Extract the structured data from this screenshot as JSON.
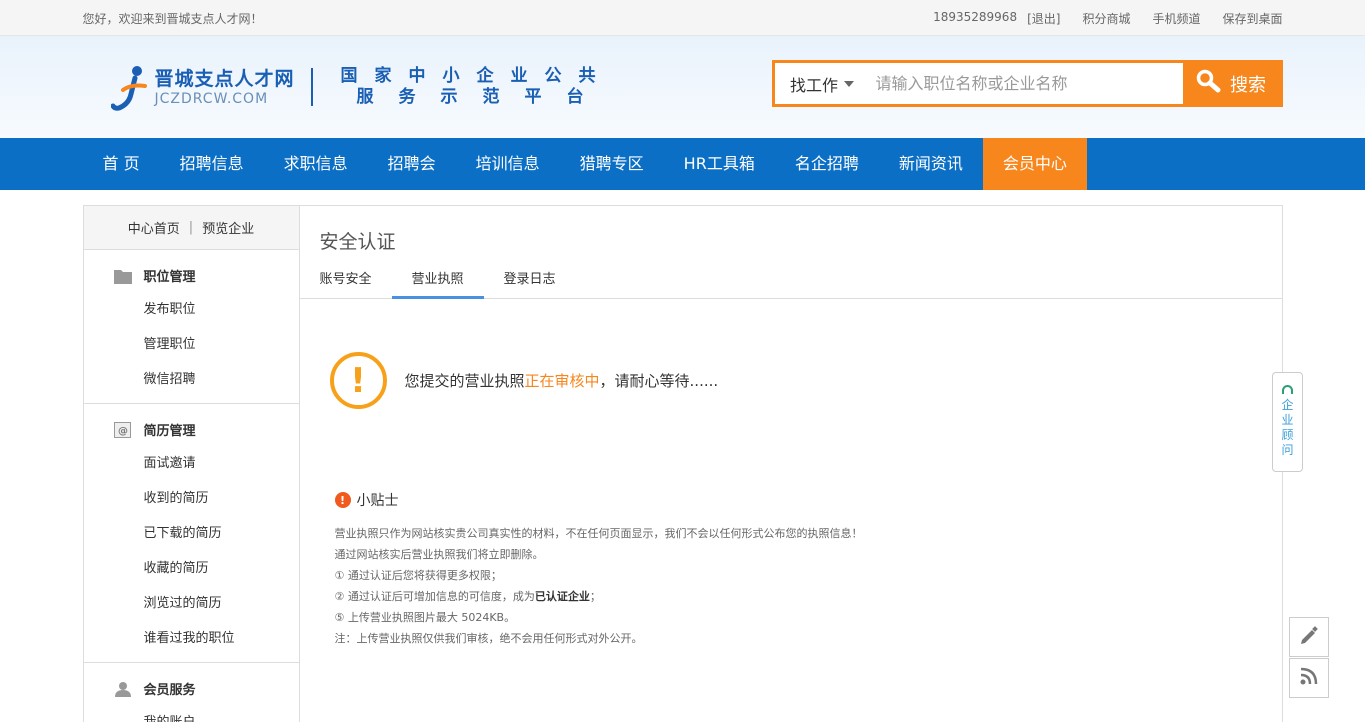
{
  "topbar": {
    "welcome": "您好，欢迎来到晋城支点人才网！",
    "phone": "18935289968",
    "logout": "[退出]",
    "links": [
      "积分商城",
      "手机频道",
      "保存到桌面"
    ]
  },
  "header": {
    "logo_cn": "晋城支点人才网",
    "logo_en": "JCZDRCW.COM",
    "slogan_line1": "国家中小企业公共",
    "slogan_line2": "服务示范平台",
    "search": {
      "type_label": "找工作",
      "placeholder": "请输入职位名称或企业名称",
      "button_label": "搜索"
    }
  },
  "nav": {
    "items": [
      "首 页",
      "招聘信息",
      "求职信息",
      "招聘会",
      "培训信息",
      "猎聘专区",
      "HR工具箱",
      "名企招聘",
      "新闻资讯",
      "会员中心"
    ],
    "active": "会员中心"
  },
  "sidebar": {
    "top_links": [
      "中心首页",
      "预览企业"
    ],
    "groups": [
      {
        "title": "职位管理",
        "icon": "folder-icon",
        "items": [
          "发布职位",
          "管理职位",
          "微信招聘"
        ]
      },
      {
        "title": "简历管理",
        "icon": "at-icon",
        "items": [
          "面试邀请",
          "收到的简历",
          "已下载的简历",
          "收藏的简历",
          "浏览过的简历",
          "谁看过我的职位"
        ]
      },
      {
        "title": "会员服务",
        "icon": "user-icon",
        "items": [
          "我的账户"
        ]
      }
    ]
  },
  "content": {
    "title": "安全认证",
    "tabs": [
      "账号安全",
      "营业执照",
      "登录日志"
    ],
    "active_tab": "营业执照",
    "status": {
      "prefix": "您提交的营业执照",
      "highlight": "正在审核中",
      "suffix": "，请耐心等待......"
    },
    "tips": {
      "title": "小贴士",
      "line1": "营业执照只作为网站核实贵公司真实性的材料，不在任何页面显示，我们不会以任何形式公布您的执照信息！",
      "line2": "通过网站核实后营业执照我们将立即删除。",
      "line3": "① 通过认证后您将获得更多权限；",
      "line4_prefix": "② 通过认证后可增加信息的可信度，成为",
      "line4_bold": "已认证企业",
      "line4_suffix": "；",
      "line5": "⑤ 上传营业执照图片最大 5024KB。",
      "line6": "注：上传营业执照仅供我们审核，绝不会用任何形式对外公开。"
    }
  },
  "floating": {
    "consult_label": [
      "企",
      "业",
      "顾",
      "问"
    ],
    "buttons": [
      "edit-icon",
      "rss-icon"
    ]
  },
  "colors": {
    "brand_blue": "#0a6fc5",
    "accent_orange": "#f7861c",
    "warn_orange": "#f7a11a",
    "tab_underline": "#4a90e2"
  }
}
